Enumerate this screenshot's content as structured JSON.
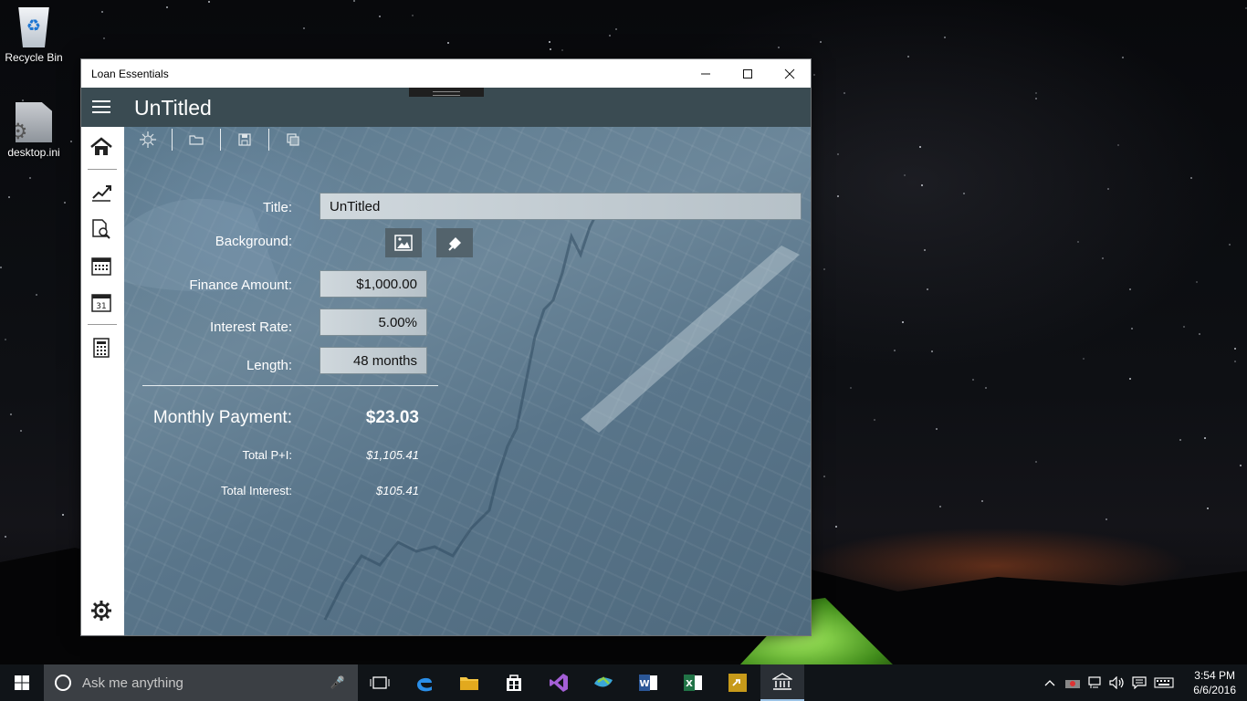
{
  "desktop": {
    "icons": [
      {
        "label": "Recycle Bin",
        "icon": "recycle-bin-icon"
      },
      {
        "label": "desktop.ini",
        "icon": "settings-file-icon"
      }
    ]
  },
  "window": {
    "title": "Loan Essentials",
    "controls": {
      "minimize": "minimize-icon",
      "maximize": "maximize-icon",
      "close": "close-icon"
    }
  },
  "header": {
    "document_title": "UnTitled"
  },
  "sidebar": {
    "items": [
      {
        "name": "home",
        "icon": "home-icon"
      },
      {
        "name": "chart",
        "icon": "chart-icon"
      },
      {
        "name": "search-document",
        "icon": "search-document-icon"
      },
      {
        "name": "calendar",
        "icon": "calendar-icon"
      },
      {
        "name": "calendar-31",
        "icon": "calendar-31-icon"
      },
      {
        "name": "calculator",
        "icon": "calculator-icon"
      }
    ],
    "settings": "gear-icon"
  },
  "toolbar": {
    "items": [
      "new-icon",
      "open-folder-icon",
      "save-icon",
      "copy-icon"
    ]
  },
  "form": {
    "title_label": "Title:",
    "title_value": "UnTitled",
    "background_label": "Background:",
    "finance_label": "Finance Amount:",
    "finance_value": "$1,000.00",
    "rate_label": "Interest Rate:",
    "rate_value": "5.00%",
    "length_label": "Length:",
    "length_value": "48 months"
  },
  "results": {
    "monthly_label": "Monthly Payment:",
    "monthly_value": "$23.03",
    "total_pi_label": "Total P+I:",
    "total_pi_value": "$1,105.41",
    "total_interest_label": "Total Interest:",
    "total_interest_value": "$105.41"
  },
  "taskbar": {
    "search_placeholder": "Ask me anything",
    "clock_time": "3:54 PM",
    "clock_date": "6/6/2016",
    "accent": "#9cc3e6"
  }
}
